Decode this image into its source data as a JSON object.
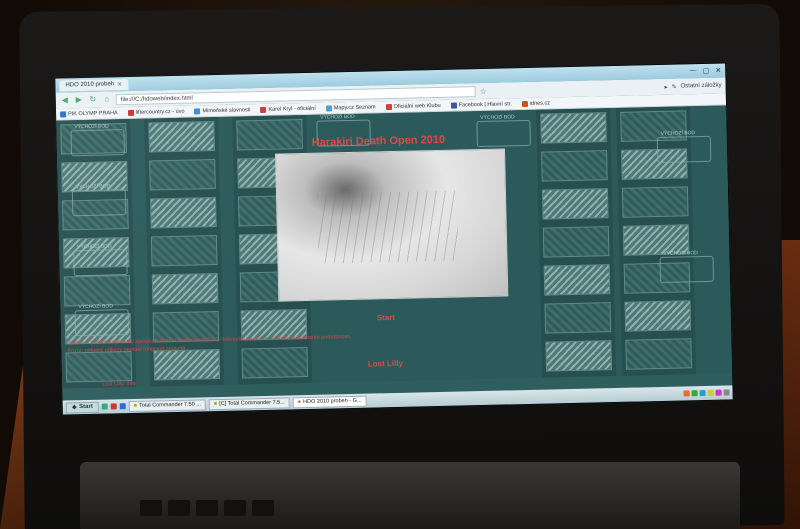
{
  "browser": {
    "tab_title": "HDO 2010 probeh",
    "url": "file:///C:/hdoweb/index.html",
    "right_label": "Ostatní záložky",
    "bookmarks": [
      {
        "label": "PIK OLYMP PRAHA",
        "color": "#2a6dc9"
      },
      {
        "label": "liftercountry.cz - úvo",
        "color": "#d03030"
      },
      {
        "label": "Mimoňské slavnosti",
        "color": "#3a8fd0"
      },
      {
        "label": "Karel Kryl - oficiální",
        "color": "#c04040"
      },
      {
        "label": "Mapy.cz Seznam",
        "color": "#4aa0d0"
      },
      {
        "label": "Oficiální web Klubu",
        "color": "#d04040"
      },
      {
        "label": "Facebook | Hlavní str.",
        "color": "#3b5998"
      },
      {
        "label": "idnes.cz",
        "color": "#d05020"
      }
    ]
  },
  "page": {
    "title": "Harakiri Death Open 2010",
    "start_label": "Start",
    "note_1": "Startovní pořadí a výsledky závodu Harakiri Death Open 2010 - kliknutím na jméno závodníka zobrazíte podrobnosti.",
    "note_2": "Pozor: některé odkazy nemusí fungovat správně.",
    "lost_label": "Lost Lilly",
    "footer": "Lost Lilly: info",
    "map_label": "VÝCHOZÍ BOD",
    "colors": {
      "accent": "#e04848",
      "background": "#2c5a5b"
    }
  },
  "taskbar": {
    "start_label": "Start",
    "tasks": [
      {
        "label": "Total Commander 7.50 ..."
      },
      {
        "label": "[C] Total Commander 7.5..."
      },
      {
        "label": "HDO 2010 probeh - G..."
      }
    ]
  }
}
